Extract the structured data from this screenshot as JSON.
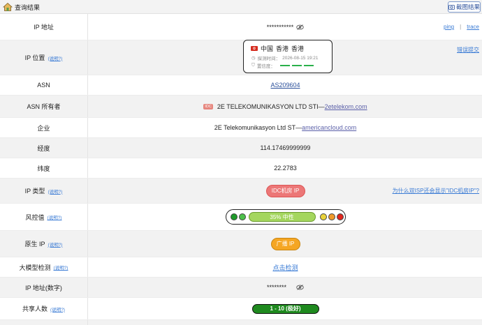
{
  "header": {
    "title": "查询结果",
    "screenshot_button": "截图结果"
  },
  "help_text": "(说明?)",
  "rows": {
    "ip": {
      "label": "IP 地址",
      "value": "***********",
      "ping": "ping",
      "sep": "|",
      "trace": "trace"
    },
    "location": {
      "label": "IP 位置",
      "country": "中国",
      "region": "香港",
      "city": "香港",
      "probe_label": "探测时间：",
      "probe_time": "2026-08-15 19:21",
      "confidence_label": "置信度：",
      "report": "错误提交"
    },
    "asn": {
      "label": "ASN",
      "value": "AS209604"
    },
    "asn_owner": {
      "label": "ASN 所有者",
      "badge": "IDC",
      "name": "2E TELEKOMUNIKASYON LTD STI—",
      "link": "2etelekom.com"
    },
    "company": {
      "label": "企业",
      "name": "2E Telekomunikasyon Ltd ST—",
      "link": "americancloud.com"
    },
    "longitude": {
      "label": "经度",
      "value": "114.17469999999"
    },
    "latitude": {
      "label": "纬度",
      "value": "22.2783"
    },
    "ip_type": {
      "label": "IP 类型",
      "value": "IDC机房 IP",
      "question": "为什么双ISP还会显示\"IDC机房IP\"?"
    },
    "risk": {
      "label": "风控值",
      "value": "35%  中性"
    },
    "native": {
      "label": "原生 IP",
      "value": "广播 IP"
    },
    "llm": {
      "label": "大模型检测",
      "value": "点击检测"
    },
    "ip_numeric": {
      "label": "IP 地址(数字)",
      "value": "********"
    },
    "shared": {
      "label": "共享人数",
      "value": "1 - 10 (极好)"
    }
  },
  "colors": {
    "accent": "#3a7bd5",
    "green": "#1f8a1f",
    "red": "#ec7777",
    "orange": "#f5a623",
    "risk": "#a4d65e"
  }
}
